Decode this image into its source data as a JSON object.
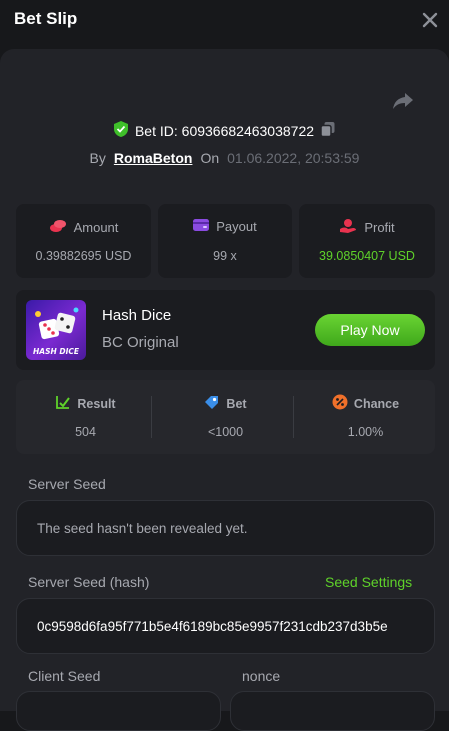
{
  "header": {
    "title": "Bet Slip"
  },
  "bet": {
    "id_text": "Bet ID: 60936682463038722",
    "by_label": "By",
    "username": "RomaBeton",
    "on_label": "On",
    "datetime": "01.06.2022, 20:53:59"
  },
  "stats": [
    {
      "label": "Amount",
      "value": "0.39882695 USD",
      "icon": "coins-icon",
      "color": "#e9334f"
    },
    {
      "label": "Payout",
      "value": "99 x",
      "icon": "wallet-icon",
      "color": "#8a4be0"
    },
    {
      "label": "Profit",
      "value": "39.0850407 USD",
      "icon": "hand-coin-icon",
      "color": "#e9334f",
      "value_color": "#5fd22a"
    }
  ],
  "game": {
    "name": "Hash Dice",
    "subtitle": "BC Original",
    "play_label": "Play Now",
    "thumbnail_text": "HASH DICE"
  },
  "results": [
    {
      "label": "Result",
      "value": "504",
      "icon": "check-chart-icon",
      "color": "#5fd22a"
    },
    {
      "label": "Bet",
      "value": "<1000",
      "icon": "tag-icon",
      "color": "#3a8ee8"
    },
    {
      "label": "Chance",
      "value": "1.00%",
      "icon": "percent-icon",
      "color": "#f0702a"
    }
  ],
  "seeds": {
    "server_seed_label": "Server Seed",
    "server_seed_value": "The seed hasn't been revealed yet.",
    "server_hash_label": "Server Seed (hash)",
    "seed_settings_label": "Seed Settings",
    "server_hash_value": "0c9598d6fa95f771b5e4f6189bc85e9957f231cdb237d3b5e",
    "client_seed_label": "Client Seed",
    "nonce_label": "nonce"
  }
}
